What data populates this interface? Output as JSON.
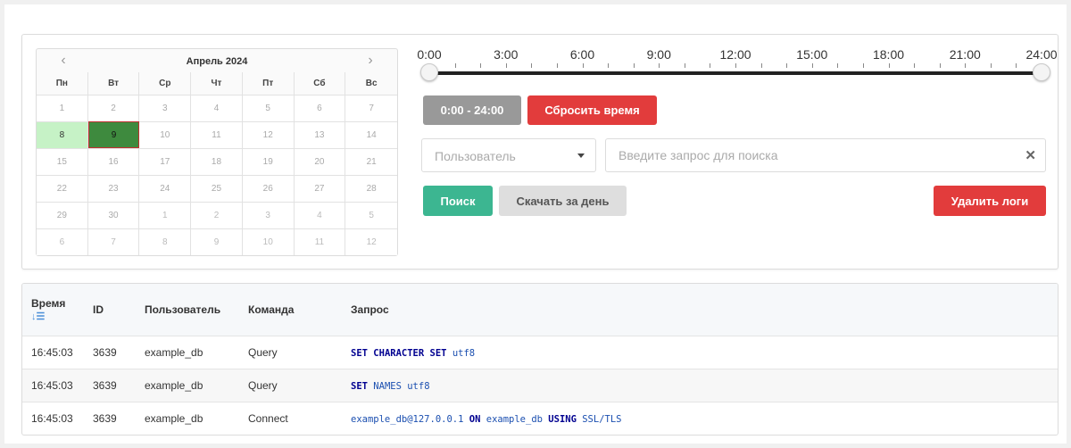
{
  "calendar": {
    "month_label": "Апрель 2024",
    "prev_icon": "chevron-left-icon",
    "next_icon": "chevron-right-icon",
    "weekdays": [
      "Пн",
      "Вт",
      "Ср",
      "Чт",
      "Пт",
      "Сб",
      "Вс"
    ],
    "days": [
      "1",
      "2",
      "3",
      "4",
      "5",
      "6",
      "7",
      "8",
      "9",
      "10",
      "11",
      "12",
      "13",
      "14",
      "15",
      "16",
      "17",
      "18",
      "19",
      "20",
      "21",
      "22",
      "23",
      "24",
      "25",
      "26",
      "27",
      "28",
      "29",
      "30",
      "1",
      "2",
      "3",
      "4",
      "5",
      "6",
      "7",
      "8",
      "9",
      "10",
      "11",
      "12"
    ],
    "available_day": "8",
    "selected_day": "9"
  },
  "time_slider": {
    "ticks": [
      "0:00",
      "3:00",
      "6:00",
      "9:00",
      "12:00",
      "15:00",
      "18:00",
      "21:00",
      "24:00"
    ],
    "range_start_hour": 0,
    "range_end_hour": 24
  },
  "buttons": {
    "range": "0:00 - 24:00",
    "reset_time": "Сбросить время",
    "search": "Поиск",
    "download_day": "Скачать за день",
    "delete_logs": "Удалить логи"
  },
  "filters": {
    "user_select_placeholder": "Пользователь",
    "query_placeholder": "Введите запрос для поиска",
    "clear_icon": "close-icon"
  },
  "table": {
    "columns": [
      "Время",
      "ID",
      "Пользователь",
      "Команда",
      "Запрос"
    ],
    "sort_icon": "sort-descending-icon",
    "rows": [
      {
        "time": "16:45:03",
        "id": "3639",
        "user": "example_db",
        "command": "Query",
        "query": "SET CHARACTER SET utf8"
      },
      {
        "time": "16:45:03",
        "id": "3639",
        "user": "example_db",
        "command": "Query",
        "query": "SET NAMES utf8"
      },
      {
        "time": "16:45:03",
        "id": "3639",
        "user": "example_db",
        "command": "Connect",
        "query": "example_db@127.0.0.1 ON example_db USING SSL/TLS"
      }
    ]
  }
}
